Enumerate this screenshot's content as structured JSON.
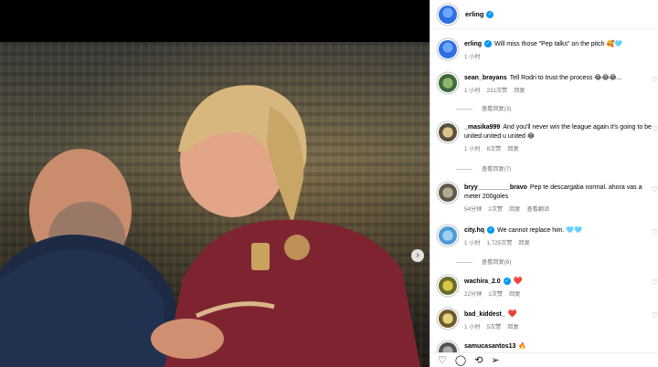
{
  "post": {
    "author": "erling",
    "caption": "Will miss those \"Pep talks\" on the pitch 🥰🩵",
    "caption_time": "1 小时"
  },
  "comments": [
    {
      "user": "sean_brayans",
      "text": "Tell Rodri to trust the process 😂😂😂...",
      "time": "1 小时",
      "likes": "231次赞",
      "reply": "回复",
      "view_replies": "查看回复(3)"
    },
    {
      "user": "_masika999",
      "text": "And you'll never win the league again it's going to be united united u united 😂",
      "time": "1 小时",
      "likes": "8次赞",
      "reply": "回复",
      "view_replies": "查看回复(7)"
    },
    {
      "user": "bryy_________bravo",
      "text": "Pep te descargaba normal. ahora vas a meter 200goles",
      "time": "54分钟",
      "likes": "2次赞",
      "reply": "回复",
      "translate": "查看翻译"
    },
    {
      "user": "city.hq",
      "text": "We cannot replace him. 🩵🩵",
      "time": "1 小时",
      "likes": "1,725次赞",
      "reply": "回复",
      "view_replies": "查看回复(6)"
    },
    {
      "user": "wachira_2.0",
      "text": "❤️",
      "time": "22分钟",
      "likes": "1次赞",
      "reply": "回复"
    },
    {
      "user": "bad_kiddest_",
      "text": "❤️",
      "time": "1 小时",
      "likes": "5次赞",
      "reply": "回复"
    },
    {
      "user": "samucasantos13",
      "text": "🔥"
    }
  ],
  "colors": {
    "verified": "#0095f6",
    "meta": "#737373",
    "heart": "#ed4956"
  },
  "icons": [
    "heart-icon",
    "comment-icon",
    "share-icon",
    "send-icon",
    "next-arrow-icon"
  ]
}
